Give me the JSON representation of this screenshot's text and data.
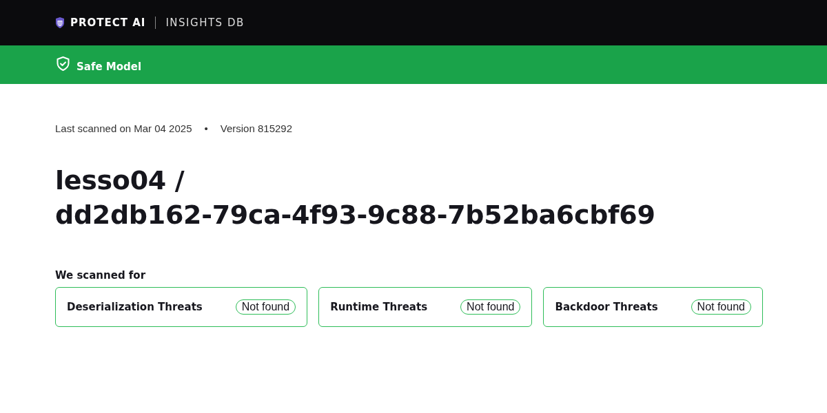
{
  "header": {
    "brand": "PROTECT AI",
    "product": "INSIGHTS DB"
  },
  "banner": {
    "kind": "safe",
    "label": "Safe Model"
  },
  "meta": {
    "scanned": "Last scanned on Mar 04 2025",
    "separator": "•",
    "version": "Version 815292"
  },
  "title": [
    "lesso04 /",
    "dd2db162-79ca-4f93-9c88-7b52ba6cbf69"
  ],
  "scan_section": {
    "heading": "We scanned for",
    "threats": [
      {
        "name": "Deserialization Threats",
        "status": "Not found"
      },
      {
        "name": "Runtime Threats",
        "status": "Not found"
      },
      {
        "name": "Backdoor Threats",
        "status": "Not found"
      }
    ]
  }
}
